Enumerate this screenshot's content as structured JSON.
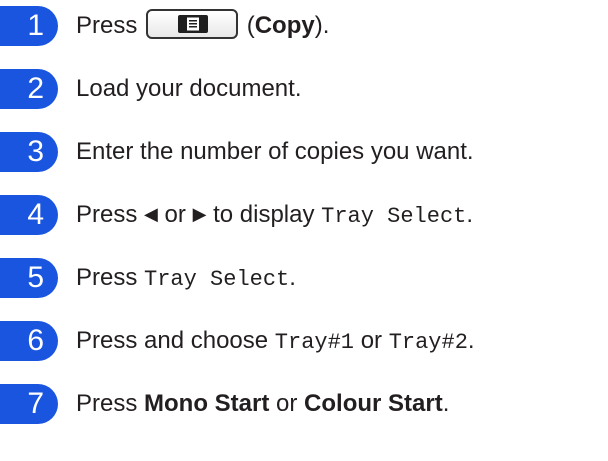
{
  "colors": {
    "badge": "#1a55e0",
    "text": "#231f20"
  },
  "steps": [
    {
      "number": "1",
      "press": "Press",
      "after": "(",
      "copy": "Copy",
      "close": ")."
    },
    {
      "number": "2",
      "text": "Load your document."
    },
    {
      "number": "3",
      "text": "Enter the number of copies you want."
    },
    {
      "number": "4",
      "press": "Press",
      "left_arrow": "◀",
      "or": "or",
      "right_arrow": "▶",
      "mid": "to display",
      "code": "Tray Select",
      "end": "."
    },
    {
      "number": "5",
      "press": "Press",
      "code": "Tray Select",
      "end": "."
    },
    {
      "number": "6",
      "text": "Press and choose",
      "code1": "Tray#1",
      "or": "or",
      "code2": "Tray#2",
      "end": "."
    },
    {
      "number": "7",
      "press": "Press",
      "bold1": "Mono Start",
      "or": "or",
      "bold2": "Colour Start",
      "end": "."
    }
  ],
  "icons": {
    "copy_key": "copy-key-icon"
  }
}
